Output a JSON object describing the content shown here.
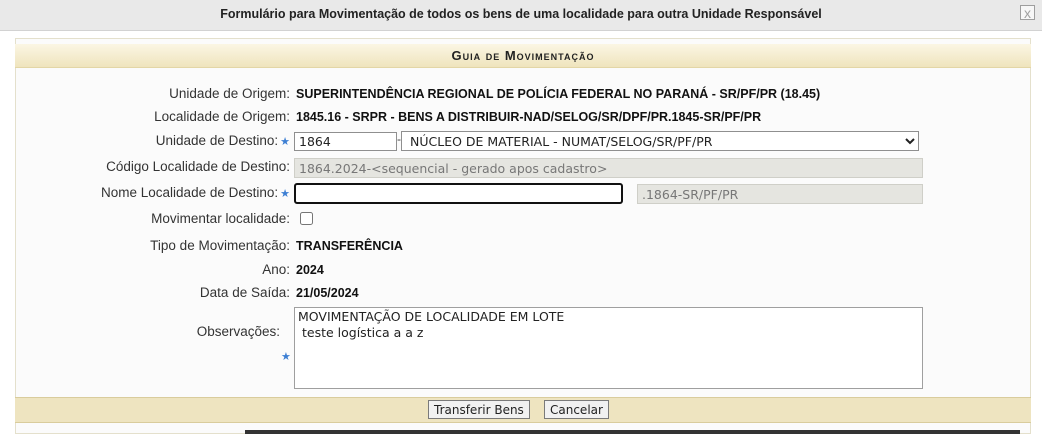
{
  "dialog": {
    "title": "Formulário para Movimentação de todos os bens de uma localidade para outra Unidade Responsável",
    "close_label": "x"
  },
  "panel": {
    "header": "Guia de Movimentação"
  },
  "form": {
    "unidade_origem": {
      "label": "Unidade de Origem:",
      "value": "SUPERINTENDÊNCIA REGIONAL DE POLÍCIA FEDERAL NO PARANÁ - SR/PF/PR (18.45)"
    },
    "localidade_origem": {
      "label": "Localidade de Origem:",
      "value": "1845.16 - SRPR - BENS A DISTRIBUIR-NAD/SELOG/SR/DPF/PR.1845-SR/PF/PR"
    },
    "unidade_destino": {
      "label": "Unidade de Destino:",
      "code": "1864",
      "separator": "-",
      "selected": "NÚCLEO DE MATERIAL - NUMAT/SELOG/SR/PF/PR"
    },
    "codigo_localidade": {
      "label": "Código Localidade de Destino:",
      "value": "1864.2024-<sequencial - gerado apos cadastro>"
    },
    "nome_localidade": {
      "label": "Nome Localidade de Destino:",
      "value": "",
      "suffix": ".1864-SR/PF/PR"
    },
    "movimentar": {
      "label": "Movimentar localidade:",
      "checked": false
    },
    "tipo": {
      "label": "Tipo de Movimentação:",
      "value": "TRANSFERÊNCIA"
    },
    "ano": {
      "label": "Ano:",
      "value": "2024"
    },
    "data_saida": {
      "label": "Data de Saída:",
      "value": "21/05/2024"
    },
    "observacoes": {
      "label": "Observações:",
      "value": "MOVIMENTAÇÃO DE LOCALIDADE EM LOTE\n teste logística a a z"
    },
    "required_marker": "★"
  },
  "buttons": {
    "transferir": "Transferir Bens",
    "cancelar": "Cancelar"
  },
  "colors": {
    "header_gradient_top": "#fbf6e4",
    "header_gradient_bottom": "#efe4bd",
    "button_bar": "#eee4c0",
    "required_star": "#3d7fd3"
  }
}
